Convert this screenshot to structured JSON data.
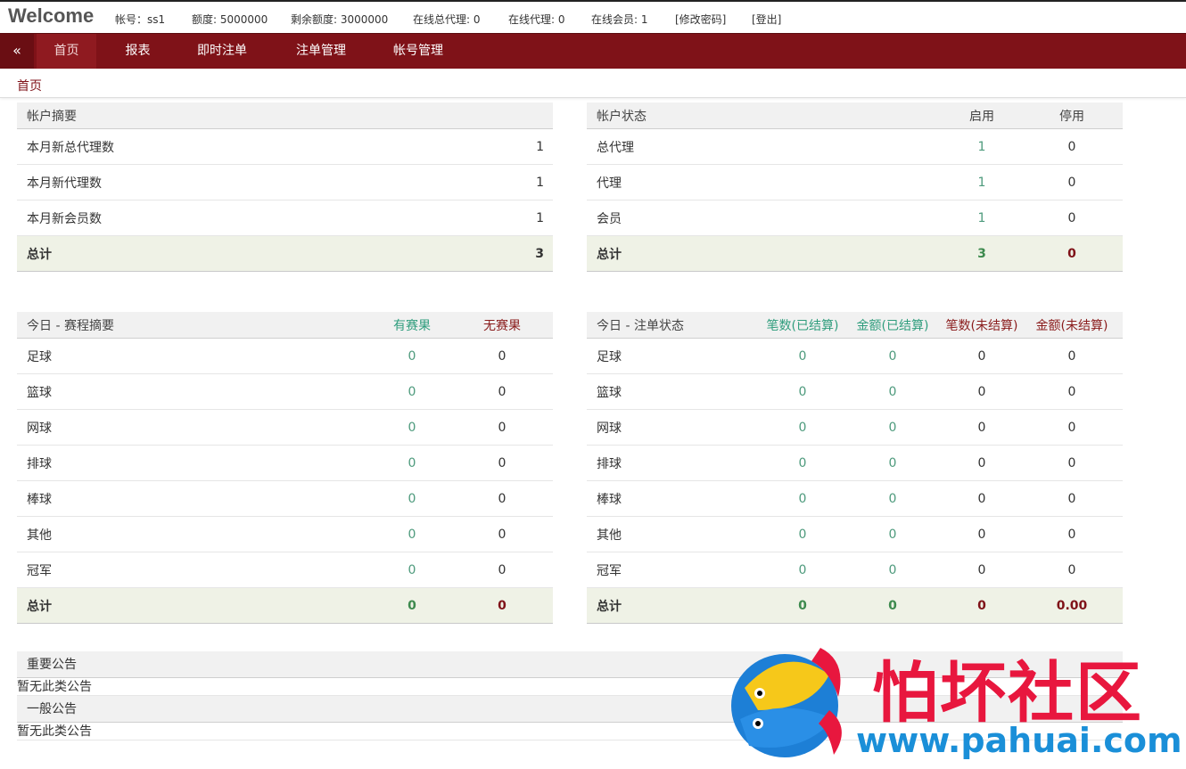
{
  "header": {
    "brand": "Welcome",
    "account_label": "帐号：ss1",
    "quota": "额度: 5000000",
    "remaining_quota": "剩余额度: 3000000",
    "online_general_agents": "在线总代理: 0",
    "online_agents": "在线代理: 0",
    "online_members": "在线会员: 1",
    "change_password": "[修改密码]",
    "logout": "[登出]"
  },
  "nav": {
    "toggle": "«",
    "items": [
      "首页",
      "报表",
      "即时注单",
      "注单管理",
      "帐号管理"
    ],
    "active": "首页"
  },
  "breadcrumb": "首页",
  "account_summary": {
    "title": "帐户摘要",
    "rows": [
      {
        "label": "本月新总代理数",
        "value": "1"
      },
      {
        "label": "本月新代理数",
        "value": "1"
      },
      {
        "label": "本月新会员数",
        "value": "1"
      }
    ],
    "total_label": "总计",
    "total_value": "3"
  },
  "account_status": {
    "title": "帐户状态",
    "col_enabled": "启用",
    "col_disabled": "停用",
    "rows": [
      {
        "label": "总代理",
        "enabled": "1",
        "disabled": "0"
      },
      {
        "label": "代理",
        "enabled": "1",
        "disabled": "0"
      },
      {
        "label": "会员",
        "enabled": "1",
        "disabled": "0"
      }
    ],
    "total_label": "总计",
    "total_enabled": "3",
    "total_disabled": "0"
  },
  "schedule_summary": {
    "title": "今日 - 赛程摘要",
    "col_result": "有赛果",
    "col_noresult": "无赛果",
    "rows": [
      {
        "label": "足球",
        "result": "0",
        "noresult": "0"
      },
      {
        "label": "篮球",
        "result": "0",
        "noresult": "0"
      },
      {
        "label": "网球",
        "result": "0",
        "noresult": "0"
      },
      {
        "label": "排球",
        "result": "0",
        "noresult": "0"
      },
      {
        "label": "棒球",
        "result": "0",
        "noresult": "0"
      },
      {
        "label": "其他",
        "result": "0",
        "noresult": "0"
      },
      {
        "label": "冠军",
        "result": "0",
        "noresult": "0"
      }
    ],
    "total_label": "总计",
    "total_result": "0",
    "total_noresult": "0"
  },
  "bet_status": {
    "title": "今日 - 注单状态",
    "col_count_settled": "笔数(已结算)",
    "col_amount_settled": "金额(已结算)",
    "col_count_unsettled": "笔数(未结算)",
    "col_amount_unsettled": "金额(未结算)",
    "rows": [
      {
        "label": "足球",
        "cs": "0",
        "as": "0",
        "cu": "0",
        "au": "0"
      },
      {
        "label": "篮球",
        "cs": "0",
        "as": "0",
        "cu": "0",
        "au": "0"
      },
      {
        "label": "网球",
        "cs": "0",
        "as": "0",
        "cu": "0",
        "au": "0"
      },
      {
        "label": "排球",
        "cs": "0",
        "as": "0",
        "cu": "0",
        "au": "0"
      },
      {
        "label": "棒球",
        "cs": "0",
        "as": "0",
        "cu": "0",
        "au": "0"
      },
      {
        "label": "其他",
        "cs": "0",
        "as": "0",
        "cu": "0",
        "au": "0"
      },
      {
        "label": "冠军",
        "cs": "0",
        "as": "0",
        "cu": "0",
        "au": "0"
      }
    ],
    "total_label": "总计",
    "total_cs": "0",
    "total_as": "0",
    "total_cu": "0",
    "total_au": "0.00"
  },
  "notices": {
    "important_title": "重要公告",
    "important_body": "暂无此类公告",
    "general_title": "一般公告",
    "general_body": "暂无此类公告"
  },
  "watermark": {
    "text": "怕坏社区",
    "url": "www.pahuai.com"
  }
}
